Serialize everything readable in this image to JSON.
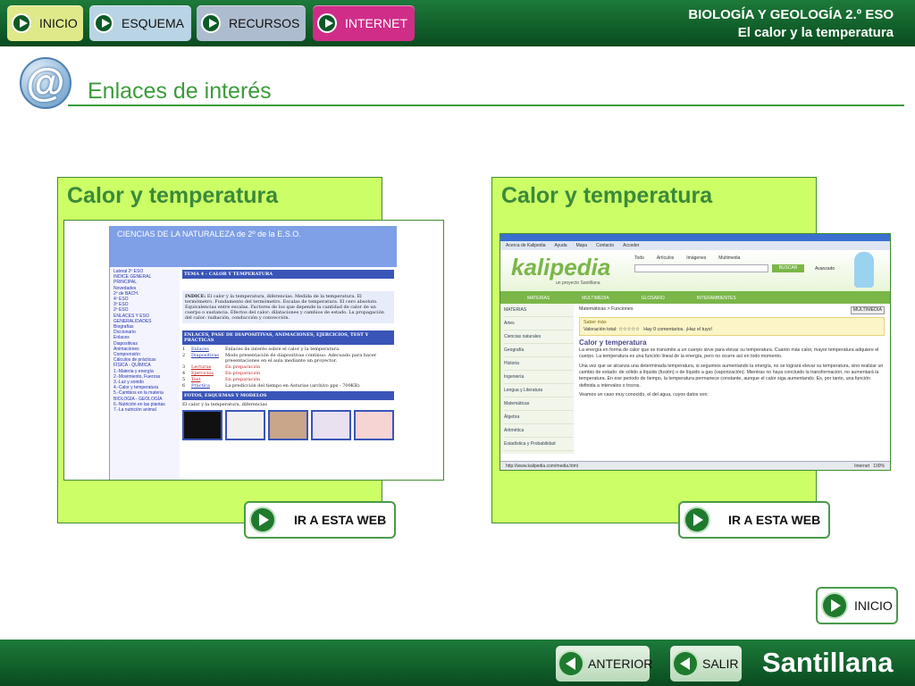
{
  "nav": {
    "inicio": "INICIO",
    "esquema": "ESQUEMA",
    "recursos": "RECURSOS",
    "internet": "INTERNET"
  },
  "subject": {
    "line1": "BIOLOGÍA Y GEOLOGÍA 2.º ESO",
    "line2": "El calor y la temperatura"
  },
  "page": {
    "title": "Enlaces de interés",
    "icon": "at-icon"
  },
  "cards": [
    {
      "title": "Calor y temperatura",
      "button": "IR A ESTA WEB",
      "screenshot": {
        "header": "CIENCIAS DE LA NATURALEZA de 2º de la E.S.O.",
        "theme": "TEMA 4 - CALOR Y TEMPERATURA",
        "index_title": "INDICE:",
        "index_text": "El calor y la temperatura, diferencias. Medida de la temperatura. El termómetro. Fundamento del termómetro. Escalas de temperatura. El cero absoluto. Equivalencias entre escalas. Factores de los que depende la cantidad de calor de un cuerpo o sustancia. Efectos del calor: dilataciones y cambios de estado. La propagación del calor: radiación, conducción y convección.",
        "links_header": "ENLACES, PASE DE DIAPOSITIVAS, ANIMACIONES, EJERCICIOS, TEST Y PRÁCTICAS",
        "rows": [
          {
            "n": "1",
            "name": "Enlaces",
            "desc": "Enlaces de interés sobre el calor y la temperatura."
          },
          {
            "n": "2",
            "name": "Diapositivas",
            "desc": "Modo presentación de diapositivas continuo. Adecuado para hacer presentaciones en el aula mediante un proyector."
          },
          {
            "n": "3",
            "name": "Lecturas",
            "desc": "En preparación"
          },
          {
            "n": "4",
            "name": "Ejercicios",
            "desc": "En preparación"
          },
          {
            "n": "5",
            "name": "Test",
            "desc": "En preparación"
          },
          {
            "n": "6",
            "name": "Práctica",
            "desc": "La predicción del tiempo en Asturias (archivo pps - 700KB)."
          }
        ],
        "photos_header": "FOTOS, ESQUEMAS Y MODELOS",
        "photos_text": "El calor y la temperatura, diferencias",
        "sidebar": [
          "Lateral 2º ESO",
          "INDICE GENERAL",
          "PRINCIPAL",
          "Novedades",
          "2º de BACH.",
          "4º ESO",
          "3º ESO",
          "2º ESO",
          "ENLACES Y ESO GENERALIDADES",
          "Biografías",
          "Diccionario",
          "Enlaces",
          "Diapositivas",
          "Animaciones",
          "Comprensión",
          "Cálculos de prácticas",
          "FÍSICA - QUÍMICA",
          "1.-Materia y energía",
          "2.-Movimiento, Fuerzas",
          "3.-Luz y sonido",
          "4.-Calor y temperatura",
          "5.-Cambios en la materia",
          "BIOLOGÍA - GEOLOGÍA",
          "6.-Nutrición en las plantas",
          "7.-La nutrición animal"
        ]
      }
    },
    {
      "title": "Calor y temperatura",
      "button": "IR A ESTA WEB",
      "screenshot": {
        "logo": "kalipedia",
        "logo_sub": "un proyecto Santillana",
        "top_links": [
          "Acerca de Kalipedia",
          "Ayuda",
          "Mapa",
          "Contacto",
          "Acceder"
        ],
        "tabs": [
          "Todo",
          "Artículos",
          "Imágenes",
          "Multimedia"
        ],
        "search_button": "BUSCAR",
        "search_adv": "Avanzado",
        "sections": [
          "MATERIAS",
          "MULTIMEDIA",
          "GLOSARIO",
          "INTERAMBIENTES"
        ],
        "menu": [
          "MATERIAS",
          "Artes",
          "Ciencias naturales",
          "Geografía",
          "Historia",
          "Ingeniería",
          "Lengua y Literatura",
          "Matemáticas",
          "Álgebra",
          "Aritmética",
          "Estadística y Probabilidad",
          "Funciones"
        ],
        "breadcrumb": "Matemáticas > Funciones",
        "badge": "MULTIMEDIA",
        "saber_mas": "Saber más",
        "rating_label": "Valoración total:",
        "comments": "Hay 0 comentarios. ¡Haz el tuyo!",
        "article_title": "Calor y temperatura",
        "p1": "La energía en forma de calor que se transmite a un cuerpo sirve para elevar su temperatura. Cuanto más calor, mayor temperatura adquiere el cuerpo. La temperatura es una función lineal de la energía, pero no ocurre así en todo momento.",
        "p2": "Una vez que se alcanza una determinada temperatura, si seguimos aumentando la energía, no se logrará elevar su temperatura, sino realizar un cambio de estado: de sólido a líquido (fusión) o de líquido a gas (vaporización). Mientras no haya concluido la transformación, no aumentará la temperatura. En ese periodo de tiempo, la temperatura permanece constante, aunque el calor siga aumentando. Es, por tanto, una función definida a intervalos o trozos.",
        "p3": "Veamos un caso muy conocido, el del agua, cuyos datos son:",
        "status_url": "http://www.kalipedia.com/media.html",
        "status_zone": "Internet",
        "status_zoom": "100%"
      }
    }
  ],
  "footer": {
    "inicio": "INICIO",
    "anterior": "ANTERIOR",
    "salir": "SALIR",
    "brand": "Santillana"
  }
}
